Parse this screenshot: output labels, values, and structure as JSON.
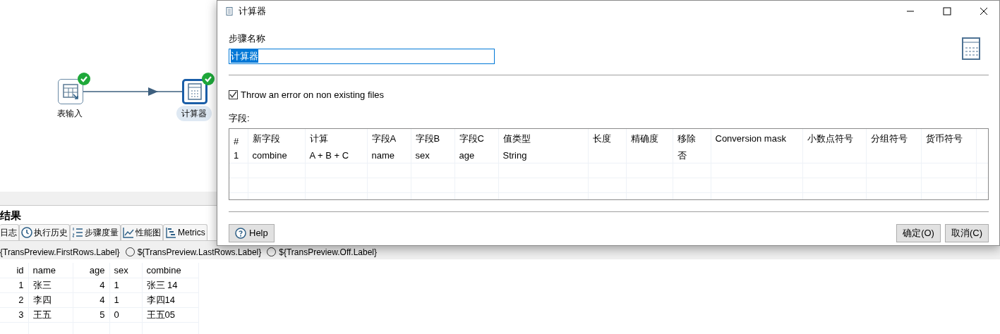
{
  "canvas": {
    "steps": [
      {
        "label": "表输入",
        "kind": "table-input",
        "selected": false,
        "ok": true
      },
      {
        "label": "计算器",
        "kind": "calculator",
        "selected": true,
        "ok": true
      }
    ]
  },
  "results_panel": {
    "title": "结果",
    "tabs": [
      {
        "label": "日志",
        "kind": "cut",
        "selected": false
      },
      {
        "label": "执行历史",
        "kind": "history",
        "selected": false
      },
      {
        "label": "步骤度量",
        "kind": "metrics",
        "selected": false
      },
      {
        "label": "性能图",
        "kind": "chart",
        "selected": false
      },
      {
        "label": "Metrics",
        "kind": "gantt",
        "selected": false
      }
    ],
    "preview_cut_label": "{TransPreview.FirstRows.Label}",
    "preview_options": [
      {
        "label": "${TransPreview.LastRows.Label}",
        "selected": false
      },
      {
        "label": "${TransPreview.Off.Label}",
        "selected": false
      }
    ],
    "table": {
      "columns": [
        "id",
        "name",
        "age",
        "sex",
        "combine"
      ],
      "rows": [
        [
          "1",
          "张三",
          "4",
          "1",
          "张三 14"
        ],
        [
          "2",
          "李四",
          "4",
          "1",
          "李四14"
        ],
        [
          "3",
          "王五",
          "5",
          "0",
          "王五05"
        ]
      ]
    }
  },
  "dialog": {
    "title": "计算器",
    "step_name_label": "步骤名称",
    "step_name": {
      "value": "计算器",
      "text_selected": true
    },
    "error_checkbox": {
      "label": "Throw an error on non existing files",
      "checked": true
    },
    "fields_label": "字段:",
    "grid": {
      "columns": [
        "#",
        "新字段",
        "计算",
        "字段A",
        "字段B",
        "字段C",
        "值类型",
        "长度",
        "精确度",
        "移除",
        "Conversion mask",
        "小数点符号",
        "分组符号",
        "货币符号"
      ],
      "rows": [
        [
          "1",
          "combine",
          "A + B + C",
          "name",
          "sex",
          "age",
          "String",
          "",
          "",
          "否",
          "",
          "",
          "",
          ""
        ]
      ]
    },
    "buttons": [
      {
        "label": "Help",
        "kind": "help"
      },
      {
        "label": "确定(O)",
        "kind": "ok"
      },
      {
        "label": "取消(C)",
        "kind": "cancel"
      }
    ]
  }
}
